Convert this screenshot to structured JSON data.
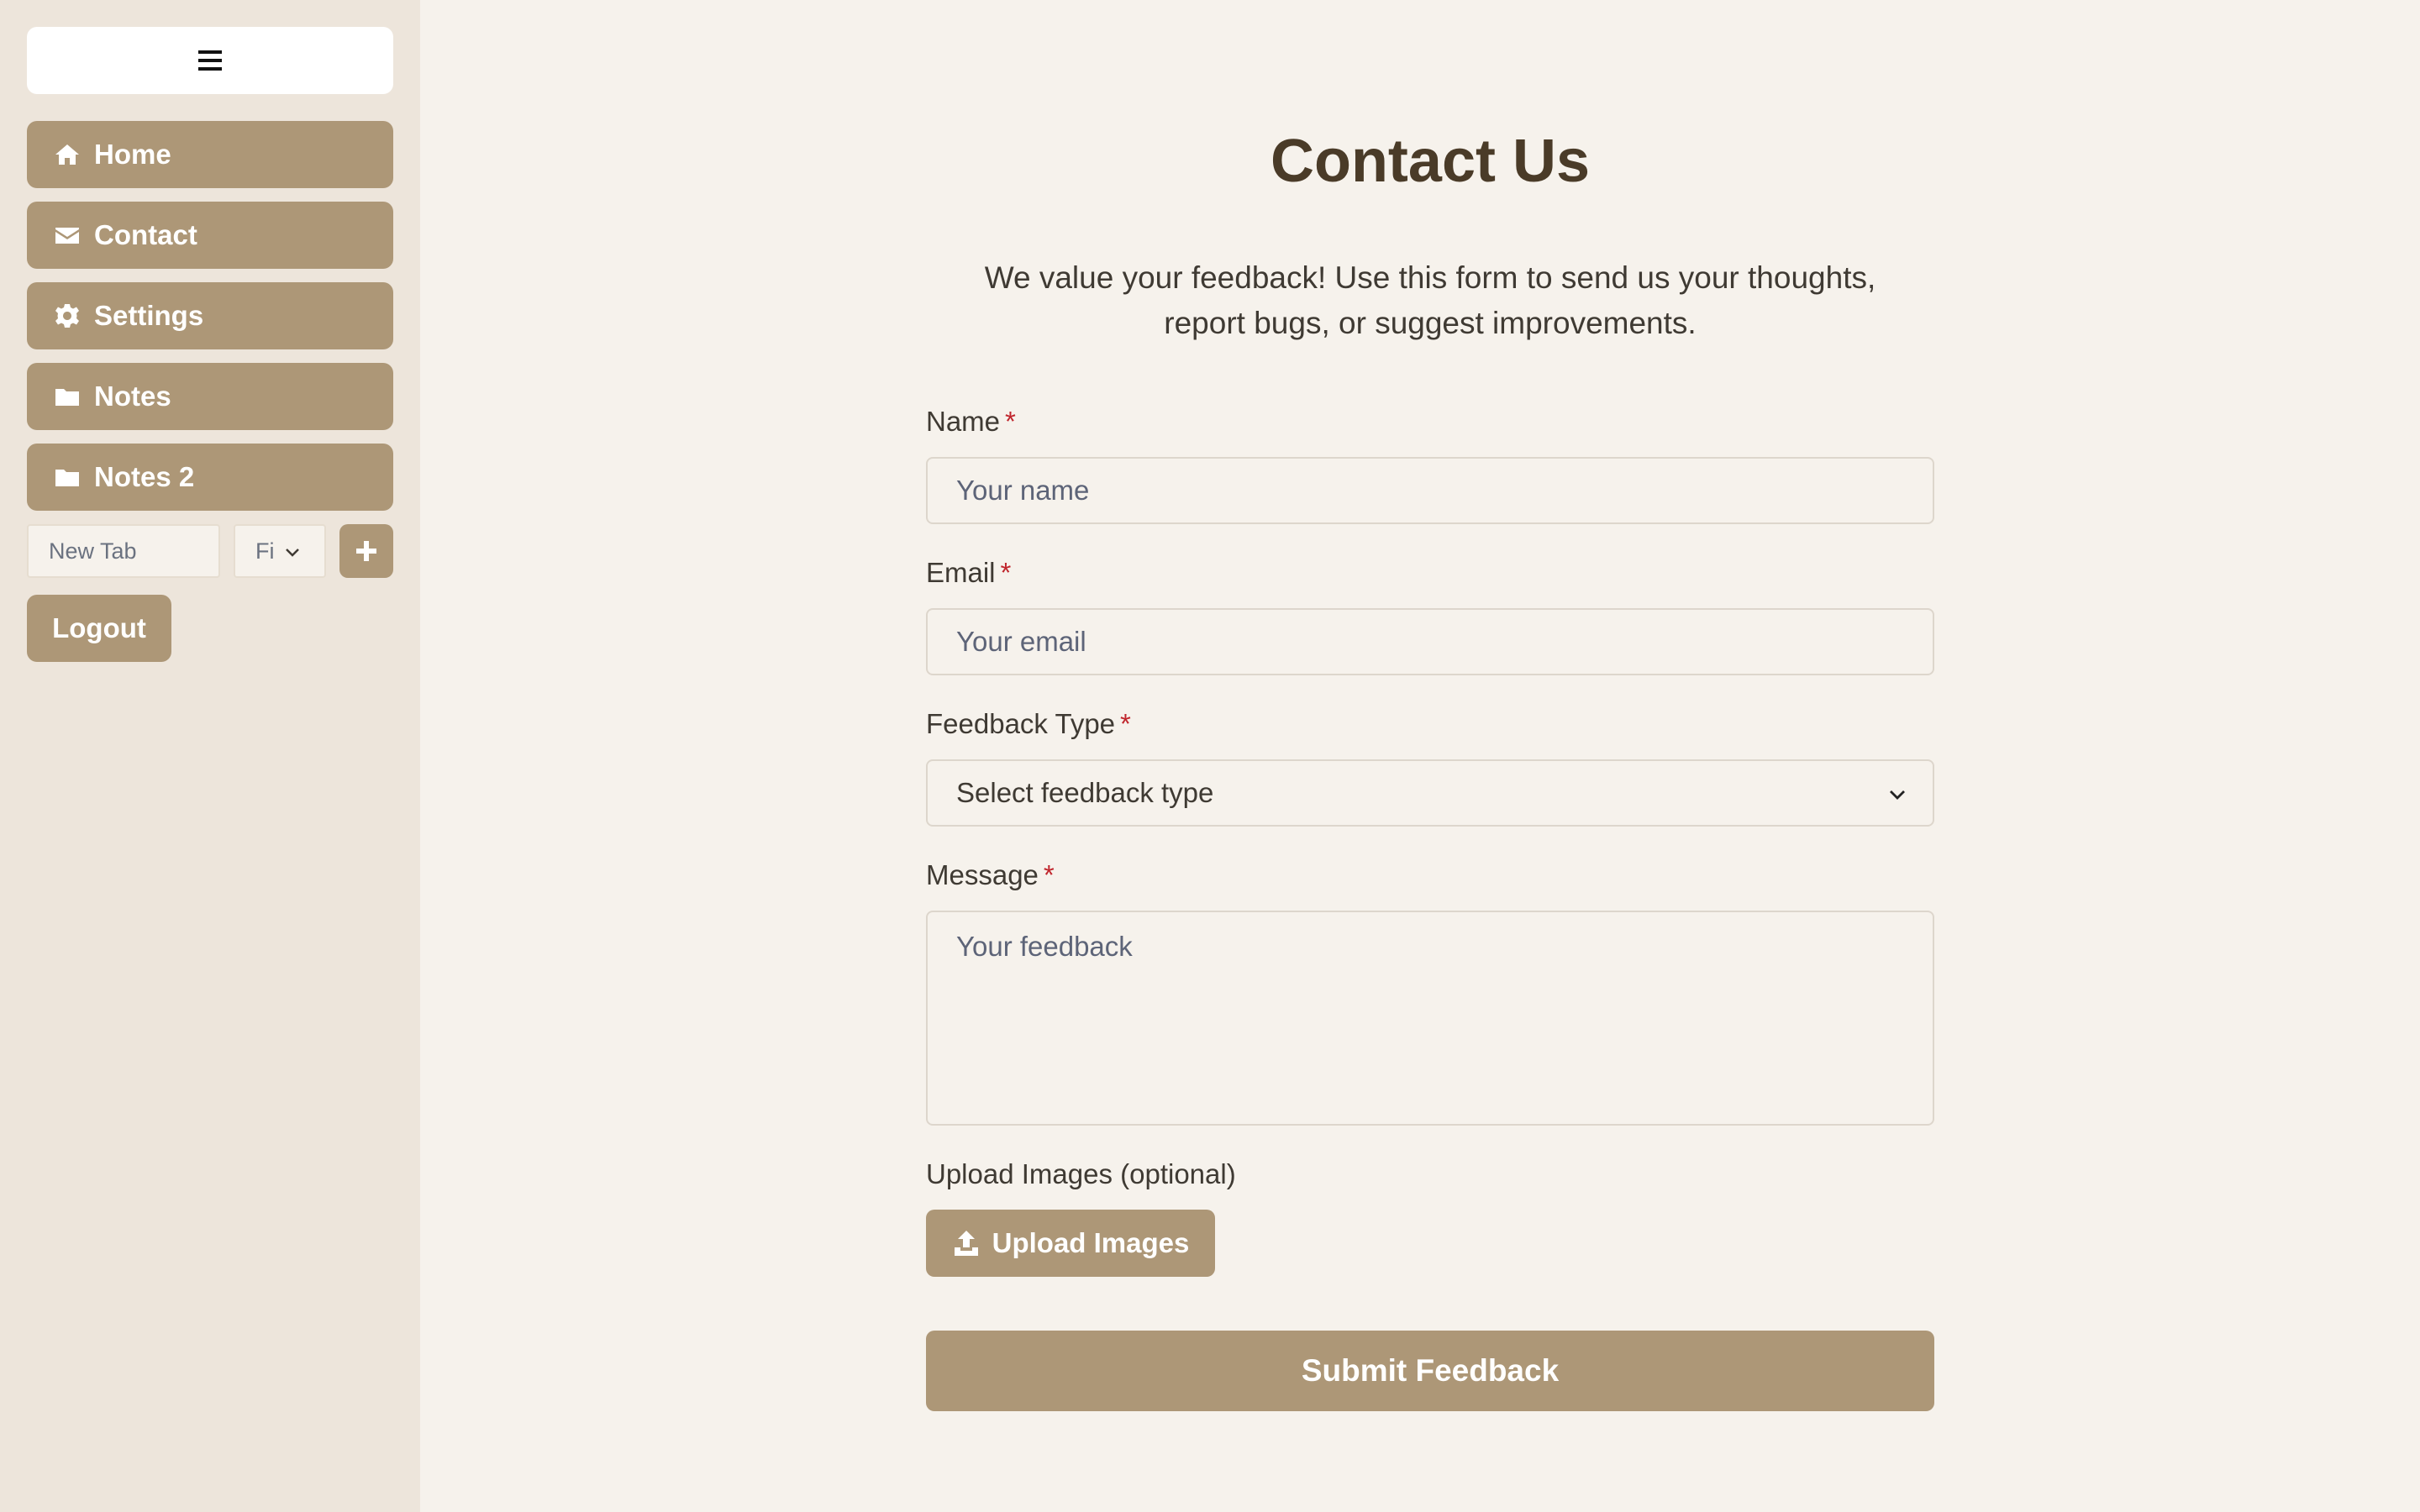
{
  "colors": {
    "accent": "#ad9777",
    "sidebar_bg": "#ede5db",
    "main_bg": "#f6f2ec",
    "title": "#4a3b28",
    "required": "#c0262d"
  },
  "sidebar": {
    "menu_icon": "hamburger-icon",
    "items": [
      {
        "label": "Home",
        "icon": "home-icon"
      },
      {
        "label": "Contact",
        "icon": "envelope-icon"
      },
      {
        "label": "Settings",
        "icon": "gear-icon"
      },
      {
        "label": "Notes",
        "icon": "folder-icon"
      },
      {
        "label": "Notes 2",
        "icon": "folder-icon"
      }
    ],
    "new_tab_placeholder": "New Tab",
    "tab_select_value": "Fi",
    "add_icon": "plus-icon",
    "logout_label": "Logout"
  },
  "form": {
    "title": "Contact Us",
    "intro": "We value your feedback! Use this form to send us your thoughts, report bugs, or suggest improvements.",
    "required_mark": "*",
    "name_label": "Name",
    "name_placeholder": "Your name",
    "email_label": "Email",
    "email_placeholder": "Your email",
    "type_label": "Feedback Type",
    "type_value": "Select feedback type",
    "message_label": "Message",
    "message_placeholder": "Your feedback",
    "upload_label": "Upload Images (optional)",
    "upload_button": "Upload Images",
    "submit_button": "Submit Feedback"
  }
}
